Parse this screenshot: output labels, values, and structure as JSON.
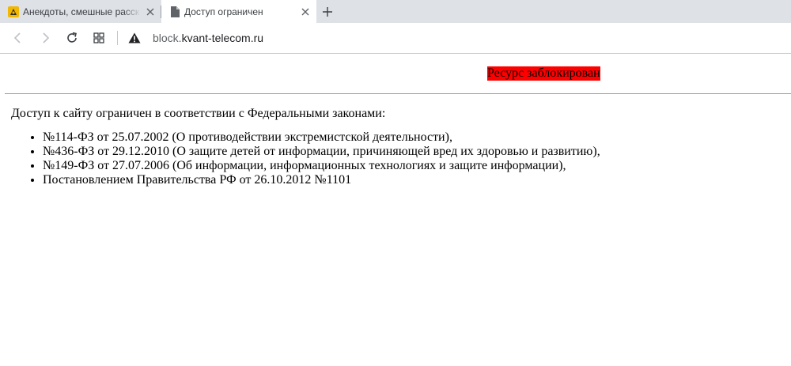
{
  "browser": {
    "tabs": [
      {
        "title": "Анекдоты, смешные расск",
        "favicon": "anekdot-favicon-icon",
        "active": false
      },
      {
        "title": "Доступ ограничен",
        "favicon": "document-icon",
        "active": true
      }
    ],
    "new_tab_label": "+",
    "address": {
      "subdomain": "block.",
      "host": "kvant-telecom.ru",
      "security_icon": "warning-triangle-icon"
    }
  },
  "page": {
    "banner": "Ресурс заблокирован",
    "banner_bg": "#ff0000",
    "intro": "Доступ к сайту ограничен в соответствии с Федеральными законами:",
    "laws": [
      "№114-ФЗ от 25.07.2002 (О противодействии экстремистской деятельности),",
      "№436-ФЗ от 29.12.2010 (О защите детей от информации, причиняющей вред их здоровью и развитию),",
      "№149-ФЗ от 27.07.2006 (Об информации, информационных технологиях и защите информации),",
      "Постановлением Правительства РФ от 26.10.2012 №1101"
    ]
  }
}
